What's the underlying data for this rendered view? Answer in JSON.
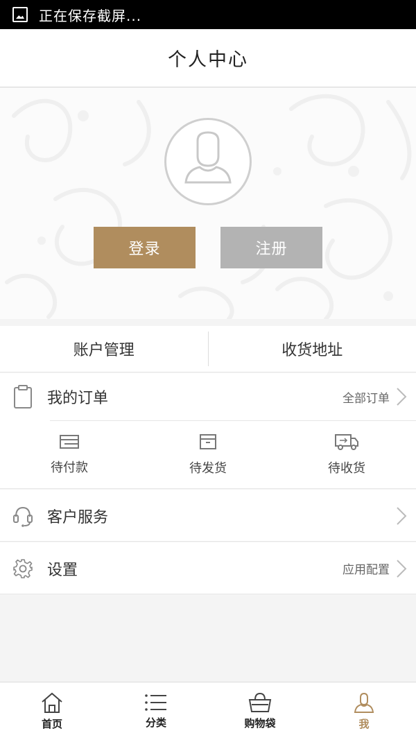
{
  "status_bar": {
    "text": "正在保存截屏..."
  },
  "header": {
    "title": "个人中心"
  },
  "hero": {
    "login_label": "登录",
    "register_label": "注册"
  },
  "account": {
    "manage_label": "账户管理",
    "address_label": "收货地址"
  },
  "orders": {
    "label": "我的订单",
    "all_label": "全部订单",
    "items": [
      {
        "label": "待付款",
        "icon": "wallet-icon"
      },
      {
        "label": "待发货",
        "icon": "box-icon"
      },
      {
        "label": "待收货",
        "icon": "truck-icon"
      }
    ]
  },
  "service": {
    "label": "客户服务"
  },
  "settings": {
    "label": "设置",
    "extra": "应用配置"
  },
  "tabbar": {
    "items": [
      {
        "label": "首页",
        "icon": "home-icon"
      },
      {
        "label": "分类",
        "icon": "list-icon"
      },
      {
        "label": "购物袋",
        "icon": "bag-icon"
      },
      {
        "label": "我",
        "icon": "user-icon"
      }
    ],
    "active_index": 3
  },
  "colors": {
    "accent": "#b08d5e",
    "muted_button": "#b3b3b3"
  }
}
